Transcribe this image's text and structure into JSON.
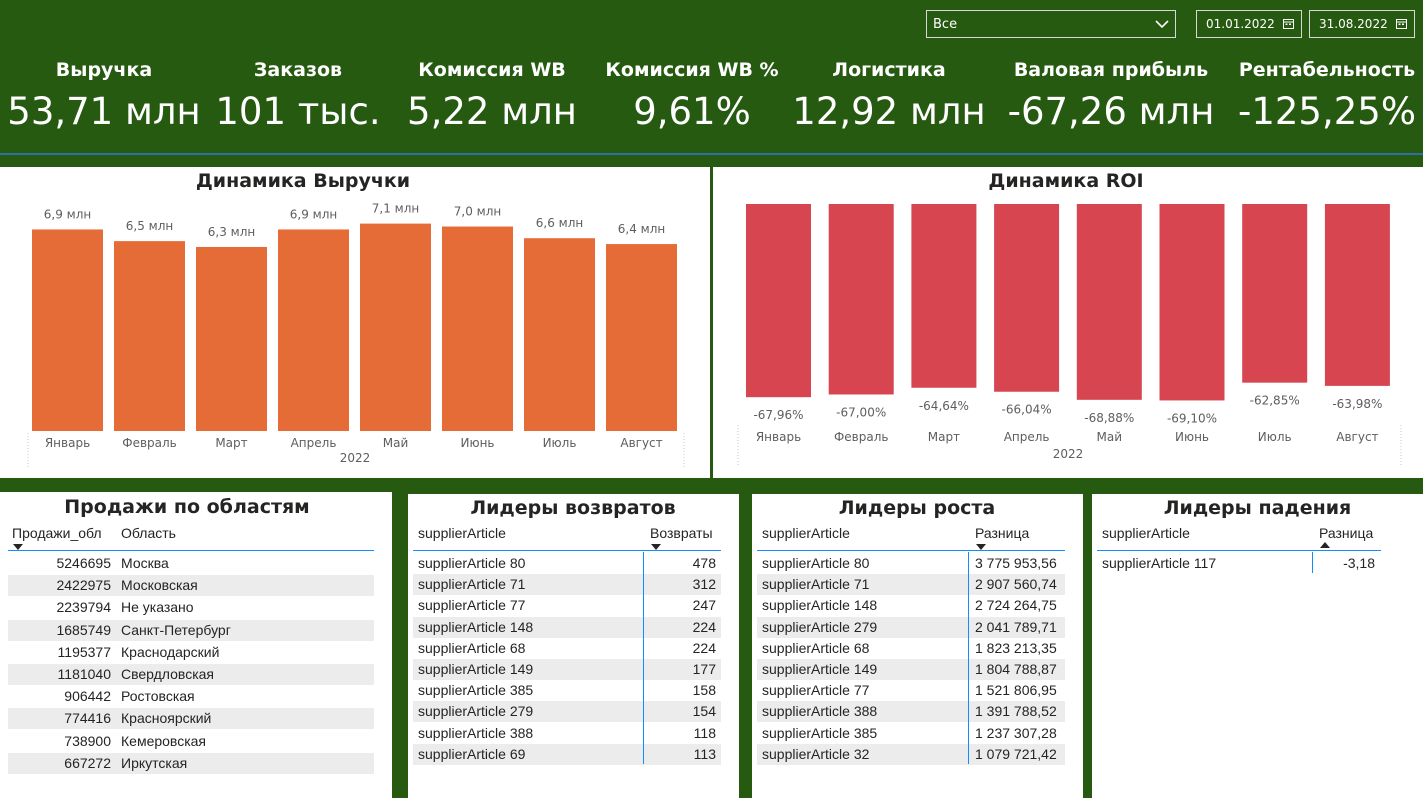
{
  "filters": {
    "select_value": "Все",
    "date_from": "01.01.2022",
    "date_to": "31.08.2022"
  },
  "kpis": [
    {
      "title": "Выручка",
      "value": "53,71 млн"
    },
    {
      "title": "Заказов",
      "value": "101 тыс."
    },
    {
      "title": "Комиссия WB",
      "value": "5,22 млн"
    },
    {
      "title": "Комиссия WB %",
      "value": "9,61%"
    },
    {
      "title": "Логистика",
      "value": "12,92 млн"
    },
    {
      "title": "Валовая прибыль",
      "value": "-67,26 млн"
    },
    {
      "title": "Рентабельность",
      "value": "-125,25%"
    }
  ],
  "colors": {
    "header_bg": "#275A11",
    "revenue_bar": "#E66C37",
    "roi_bar": "#D64550",
    "panel_bg": "#FFFFFF",
    "accent_line": "#118DFF"
  },
  "chart_data": [
    {
      "type": "bar",
      "title": "Динамика Выручки",
      "categories": [
        "Январь",
        "Февраль",
        "Март",
        "Апрель",
        "Май",
        "Июнь",
        "Июль",
        "Август"
      ],
      "group_label": "2022",
      "values": [
        6.9,
        6.5,
        6.3,
        6.9,
        7.1,
        7.0,
        6.6,
        6.4
      ],
      "value_labels": [
        "6,9 млн",
        "6,5 млн",
        "6,3 млн",
        "6,9 млн",
        "7,1 млн",
        "7,0 млн",
        "6,6 млн",
        "6,4 млн"
      ],
      "ylim": [
        0,
        7.6
      ],
      "grid": false
    },
    {
      "type": "bar",
      "title": "Динамика ROI",
      "categories": [
        "Январь",
        "Февраль",
        "Март",
        "Апрель",
        "Май",
        "Июнь",
        "Июль",
        "Август"
      ],
      "group_label": "2022",
      "values": [
        -67.96,
        -67.0,
        -64.64,
        -66.04,
        -68.88,
        -69.1,
        -62.85,
        -63.98
      ],
      "value_labels": [
        "-67,96%",
        "-67,00%",
        "-64,64%",
        "-66,04%",
        "-68,88%",
        "-69,10%",
        "-62,85%",
        "-63,98%"
      ],
      "ylim": [
        -70,
        0
      ],
      "grid": false
    }
  ],
  "regions": {
    "title": "Продажи по областям",
    "col1": "Продажи_обл",
    "col2": "Область",
    "rows": [
      [
        "5246695",
        "Москва"
      ],
      [
        "2422975",
        "Московская"
      ],
      [
        "2239794",
        "Не указано"
      ],
      [
        "1685749",
        "Санкт-Петербург"
      ],
      [
        "1195377",
        "Краснодарский"
      ],
      [
        "1181040",
        "Свердловская"
      ],
      [
        "906442",
        "Ростовская"
      ],
      [
        "774416",
        "Красноярский"
      ],
      [
        "738900",
        "Кемеровская"
      ],
      [
        "667272",
        "Иркутская"
      ]
    ]
  },
  "returns": {
    "title": "Лидеры возвратов",
    "col1": "supplierArticle",
    "col2": "Возвраты",
    "rows": [
      [
        "supplierArticle 80",
        "478"
      ],
      [
        "supplierArticle 71",
        "312"
      ],
      [
        "supplierArticle 77",
        "247"
      ],
      [
        "supplierArticle 148",
        "224"
      ],
      [
        "supplierArticle 68",
        "224"
      ],
      [
        "supplierArticle 149",
        "177"
      ],
      [
        "supplierArticle 385",
        "158"
      ],
      [
        "supplierArticle 279",
        "154"
      ],
      [
        "supplierArticle 388",
        "118"
      ],
      [
        "supplierArticle 69",
        "113"
      ]
    ]
  },
  "growth": {
    "title": "Лидеры роста",
    "col1": "supplierArticle",
    "col2": "Разница",
    "rows": [
      [
        "supplierArticle 80",
        "3 775 953,56"
      ],
      [
        "supplierArticle 71",
        "2 907 560,74"
      ],
      [
        "supplierArticle 148",
        "2 724 264,75"
      ],
      [
        "supplierArticle 279",
        "2 041 789,71"
      ],
      [
        "supplierArticle 68",
        "1 823 213,35"
      ],
      [
        "supplierArticle 149",
        "1 804 788,87"
      ],
      [
        "supplierArticle 77",
        "1 521 806,95"
      ],
      [
        "supplierArticle 388",
        "1 391 788,52"
      ],
      [
        "supplierArticle 385",
        "1 237 307,28"
      ],
      [
        "supplierArticle 32",
        "1 079 721,42"
      ]
    ]
  },
  "decline": {
    "title": "Лидеры падения",
    "col1": "supplierArticle",
    "col2": "Разница",
    "rows": [
      [
        "supplierArticle 117",
        "-3,18"
      ]
    ]
  }
}
